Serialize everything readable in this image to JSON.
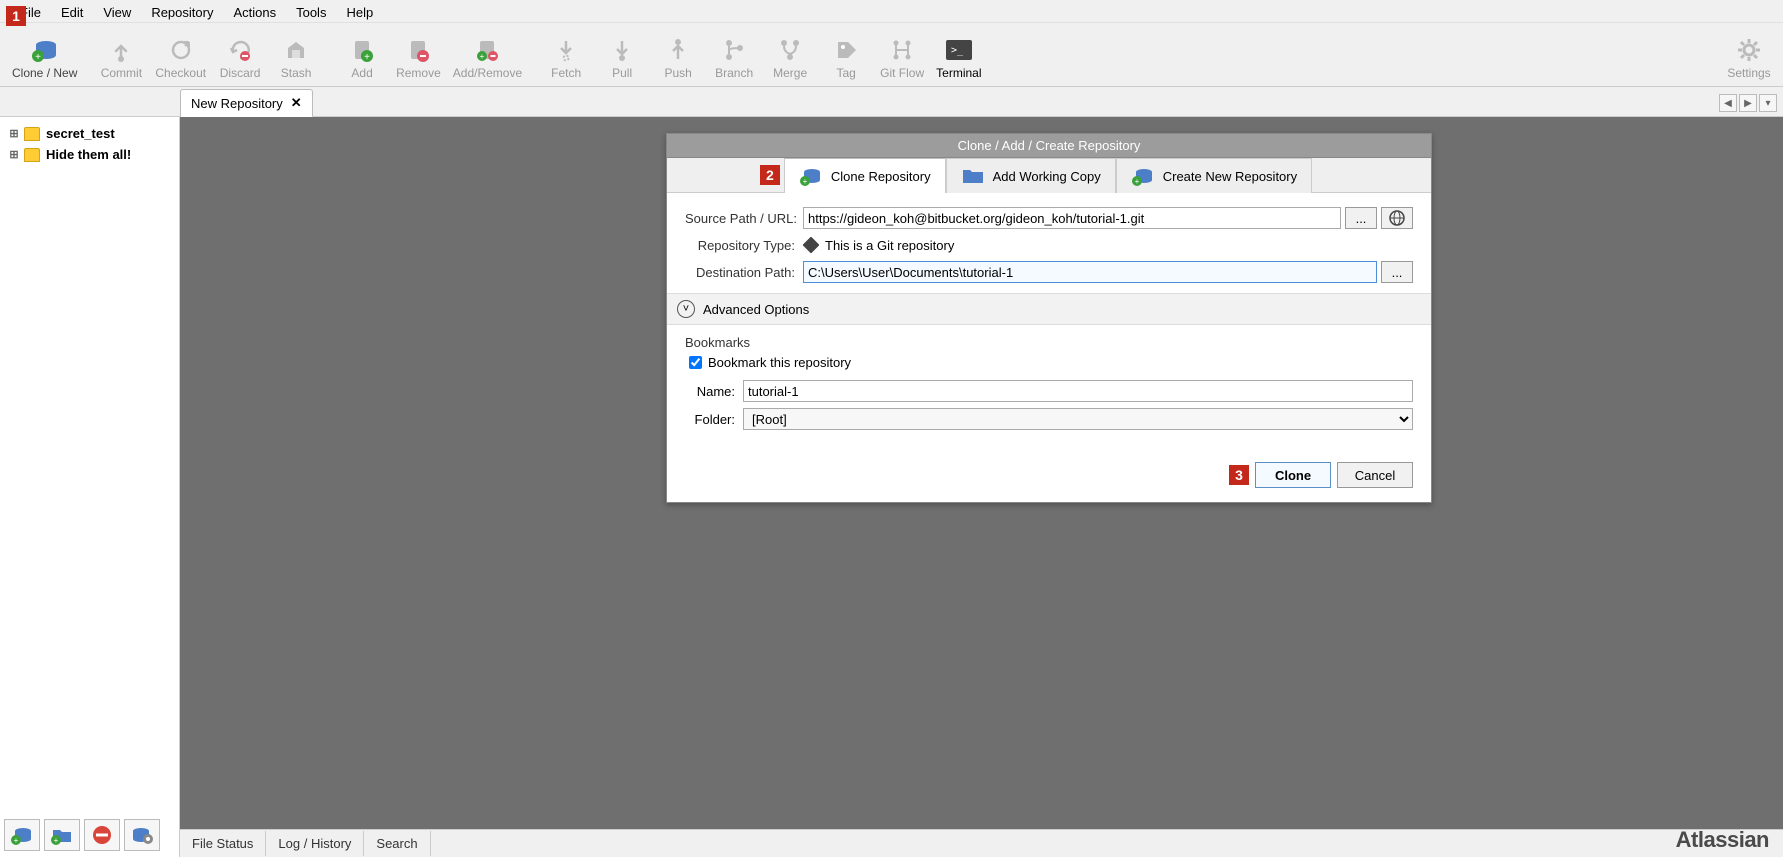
{
  "menubar": [
    "File",
    "Edit",
    "View",
    "Repository",
    "Actions",
    "Tools",
    "Help"
  ],
  "toolbar": {
    "clone_new": "Clone / New",
    "commit": "Commit",
    "checkout": "Checkout",
    "discard": "Discard",
    "stash": "Stash",
    "add": "Add",
    "remove": "Remove",
    "add_remove": "Add/Remove",
    "fetch": "Fetch",
    "pull": "Pull",
    "push": "Push",
    "branch": "Branch",
    "merge": "Merge",
    "tag": "Tag",
    "git_flow": "Git Flow",
    "terminal": "Terminal",
    "settings": "Settings"
  },
  "tabs": {
    "new_repo": "New Repository"
  },
  "sidebar": {
    "items": [
      {
        "label": "secret_test"
      },
      {
        "label": "Hide them all!"
      }
    ]
  },
  "dialog": {
    "title": "Clone  / Add / Create Repository",
    "tab_clone": "Clone Repository",
    "tab_add": "Add Working Copy",
    "tab_create": "Create New Repository",
    "source_label": "Source Path / URL:",
    "source_value": "https://gideon_koh@bitbucket.org/gideon_koh/tutorial-1.git",
    "repo_type_label": "Repository Type:",
    "repo_type_value": "This is a Git repository",
    "dest_label": "Destination Path:",
    "dest_value": "C:\\Users\\User\\Documents\\tutorial-1",
    "advanced": "Advanced Options",
    "bm_head": "Bookmarks",
    "bm_check": "Bookmark this repository",
    "bm_name_label": "Name:",
    "bm_name_value": "tutorial-1",
    "bm_folder_label": "Folder:",
    "bm_folder_value": "[Root]",
    "clone_btn": "Clone",
    "cancel_btn": "Cancel",
    "browse_dots": "..."
  },
  "statusbar": {
    "file_status": "File Status",
    "log_history": "Log / History",
    "search": "Search"
  },
  "brand": "Atlassian",
  "markers": {
    "m1": "1",
    "m2": "2",
    "m3": "3"
  }
}
